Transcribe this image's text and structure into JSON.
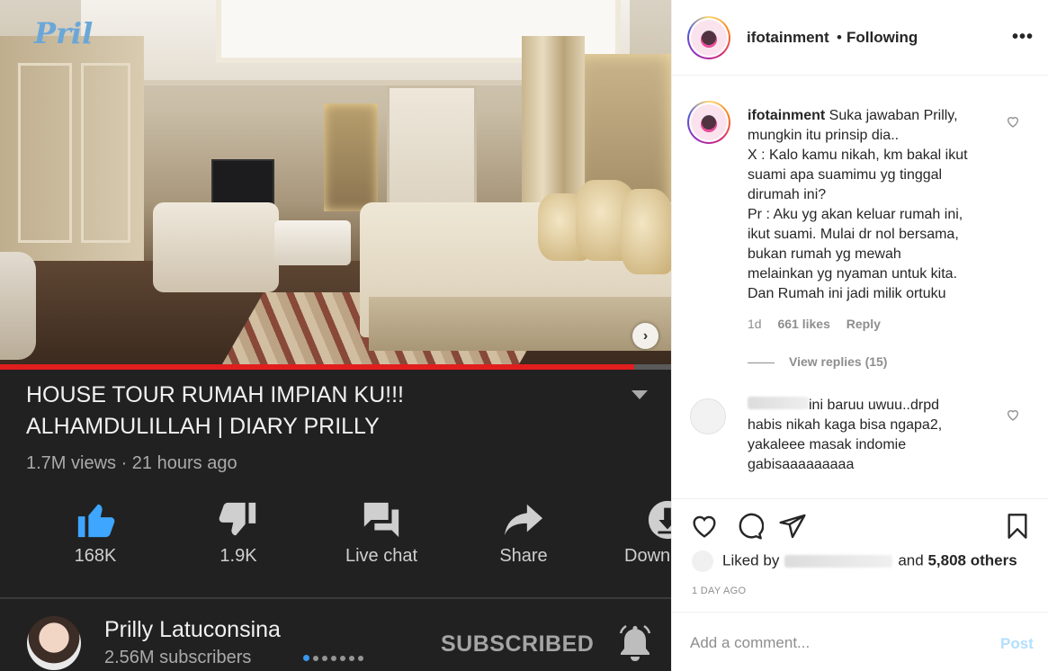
{
  "video": {
    "watermark": "Pril",
    "progress_fraction": 0.945,
    "title_line1": "HOUSE TOUR RUMAH IMPIAN KU!!!",
    "title_line2": "ALHAMDULILLAH | DIARY PRILLY",
    "meta": "1.7M views · 21 hours ago",
    "actions": {
      "like": "168K",
      "dislike": "1.9K",
      "live_chat": "Live chat",
      "share": "Share",
      "download": "Down"
    },
    "channel": {
      "name": "Prilly Latuconsina",
      "subscribers": "2.56M subscribers",
      "subscribed_label": "SUBSCRIBED"
    },
    "carousel": {
      "count": 7,
      "active": 0
    },
    "accent": "#e21d1d"
  },
  "post": {
    "username": "ifotainment",
    "dot": "•",
    "follow_state": "Following",
    "more": "•••",
    "caption_user": "ifotainment",
    "caption_lines": [
      "Suka jawaban Prilly,",
      "mungkin itu prinsip dia..",
      "X : Kalo kamu nikah, km bakal ikut",
      "suami apa suamimu yg tinggal",
      "dirumah ini?",
      "Pr : Aku yg akan keluar rumah ini,",
      "ikut suami. Mulai dr nol bersama,",
      "bukan rumah yg mewah",
      "melainkan yg nyaman untuk kita.",
      "Dan Rumah ini jadi milik ortuku"
    ],
    "caption_age": "1d",
    "caption_likes": "661 likes",
    "reply": "Reply",
    "view_replies": "View replies (15)",
    "comment_lines": [
      "ini baruu uwuu..drpd",
      "habis nikah kaga bisa ngapa2,",
      "yakaleee masak indomie",
      "gabisaaaaaaaaa"
    ],
    "liked_by_prefix": "Liked by",
    "liked_by_suffix": "and",
    "others": "5,808 others",
    "date": "1 DAY AGO",
    "comment_placeholder": "Add a comment...",
    "post_button": "Post"
  }
}
